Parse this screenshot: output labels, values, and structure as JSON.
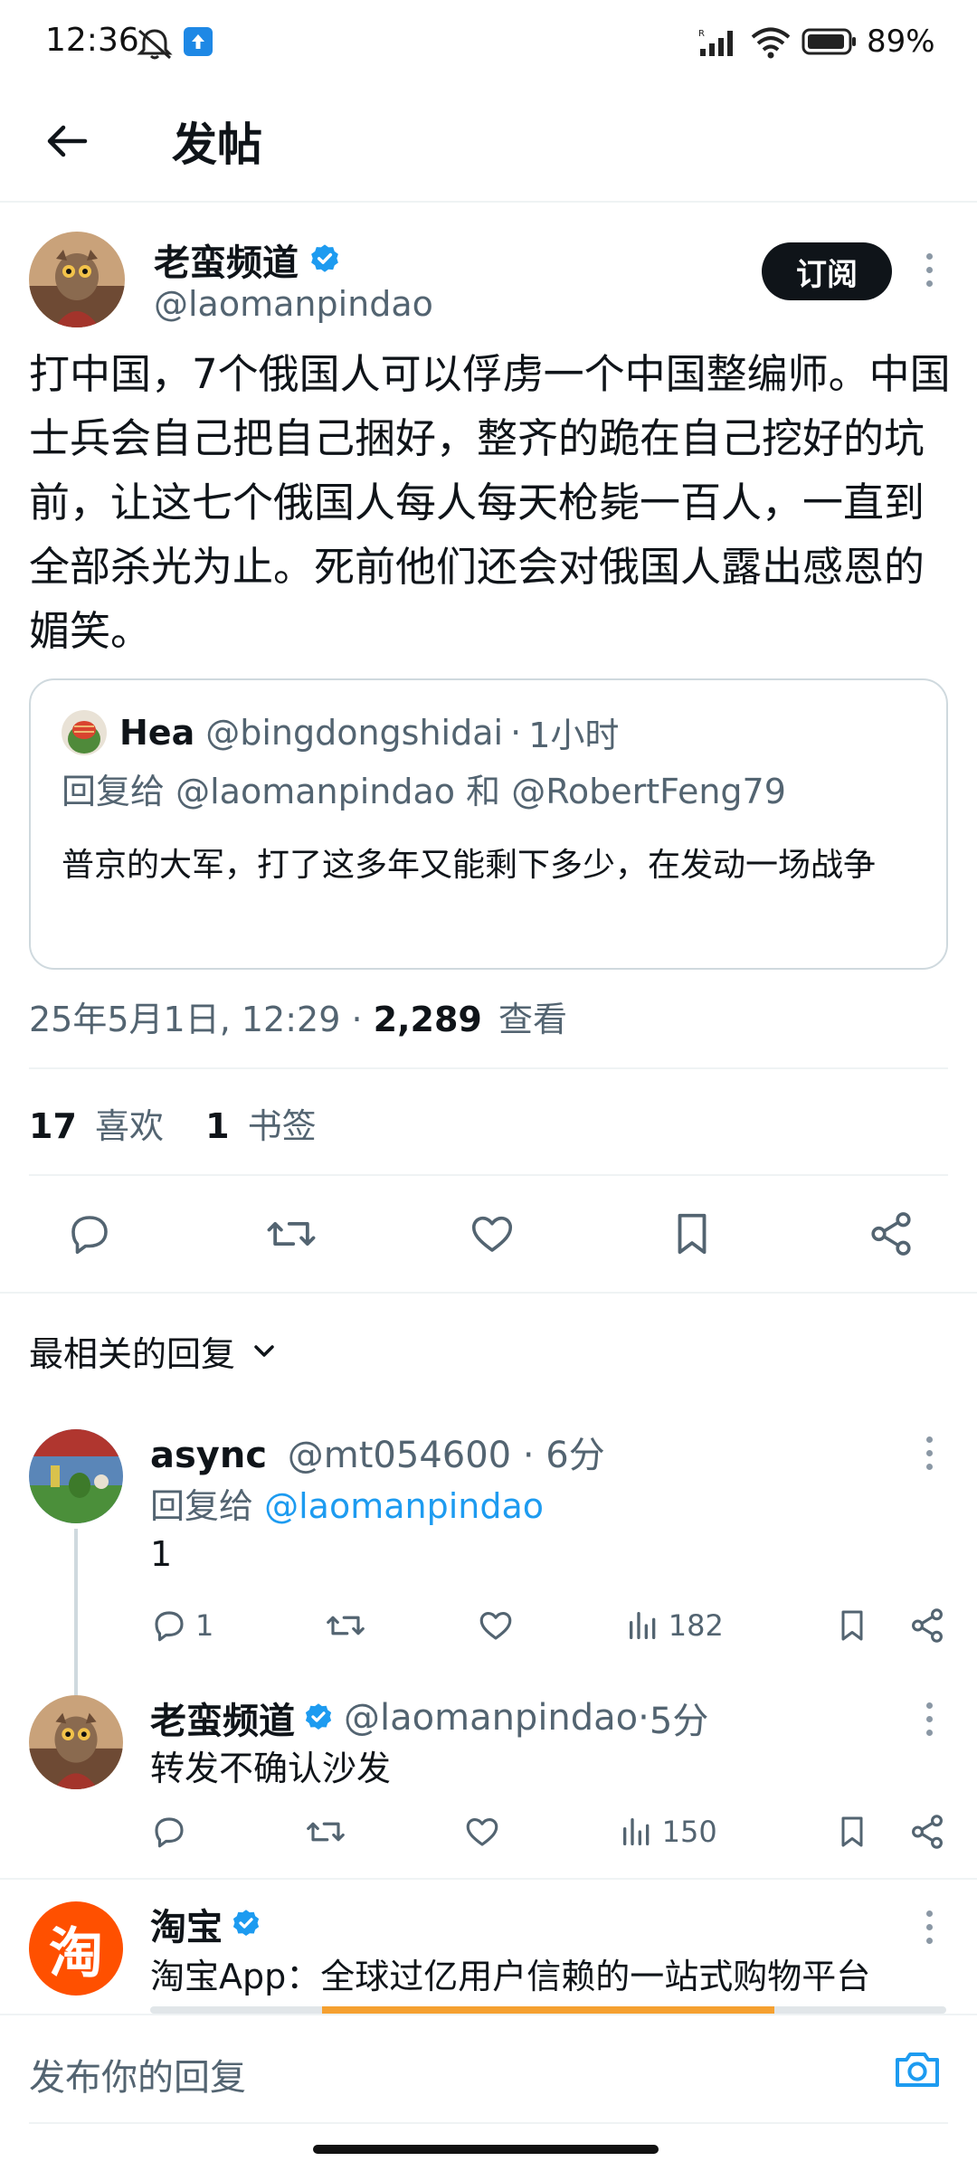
{
  "status_bar": {
    "time": "12:36",
    "battery": "89%"
  },
  "header": {
    "title": "发帖"
  },
  "post": {
    "author_name": "老蛮频道",
    "author_handle": "@laomanpindao",
    "subscribe_label": "订阅",
    "body": "打中国，7个俄国人可以俘虏一个中国整编师。中国士兵会自己把自己捆好，整齐的跪在自己挖好的坑前，让这七个俄国人每人每天枪毙一百人，一直到全部杀光为止。死前他们还会对俄国人露出感恩的媚笑。",
    "quote": {
      "name": "Hea",
      "handle": "@bingdongshidai",
      "time": "1小时",
      "reply_prefix": "回复给",
      "reply_to_1": "@laomanpindao",
      "reply_and": "和",
      "reply_to_2": "@RobertFeng79",
      "body": "普京的大军，打了这多年又能剩下多少，在发动一场战争"
    },
    "timestamp": "25年5月1日, 12:29",
    "views_count": "2,289",
    "views_label": "查看",
    "likes_count": "17",
    "likes_label": "喜欢",
    "bookmarks_count": "1",
    "bookmarks_label": "书签"
  },
  "replies_section": {
    "sort_label": "最相关的回复"
  },
  "replies": [
    {
      "name": "async",
      "handle": "@mt054600",
      "time": "6分",
      "reply_prefix": "回复给",
      "reply_to": "@laomanpindao",
      "body": "1",
      "reply_count": "1",
      "views": "182"
    },
    {
      "name": "老蛮频道",
      "handle": "@laomanpindao",
      "time": "5分",
      "body": "转发不确认沙发",
      "views": "150"
    }
  ],
  "ad": {
    "name": "淘宝",
    "logo_char": "淘",
    "body": "淘宝App：全球过亿用户信赖的一站式购物平台"
  },
  "compose": {
    "placeholder": "发布你的回复"
  },
  "colors": {
    "accent": "#1d9bf0",
    "text": "#0f1419",
    "muted": "#536471",
    "taobao": "#ff5000"
  }
}
